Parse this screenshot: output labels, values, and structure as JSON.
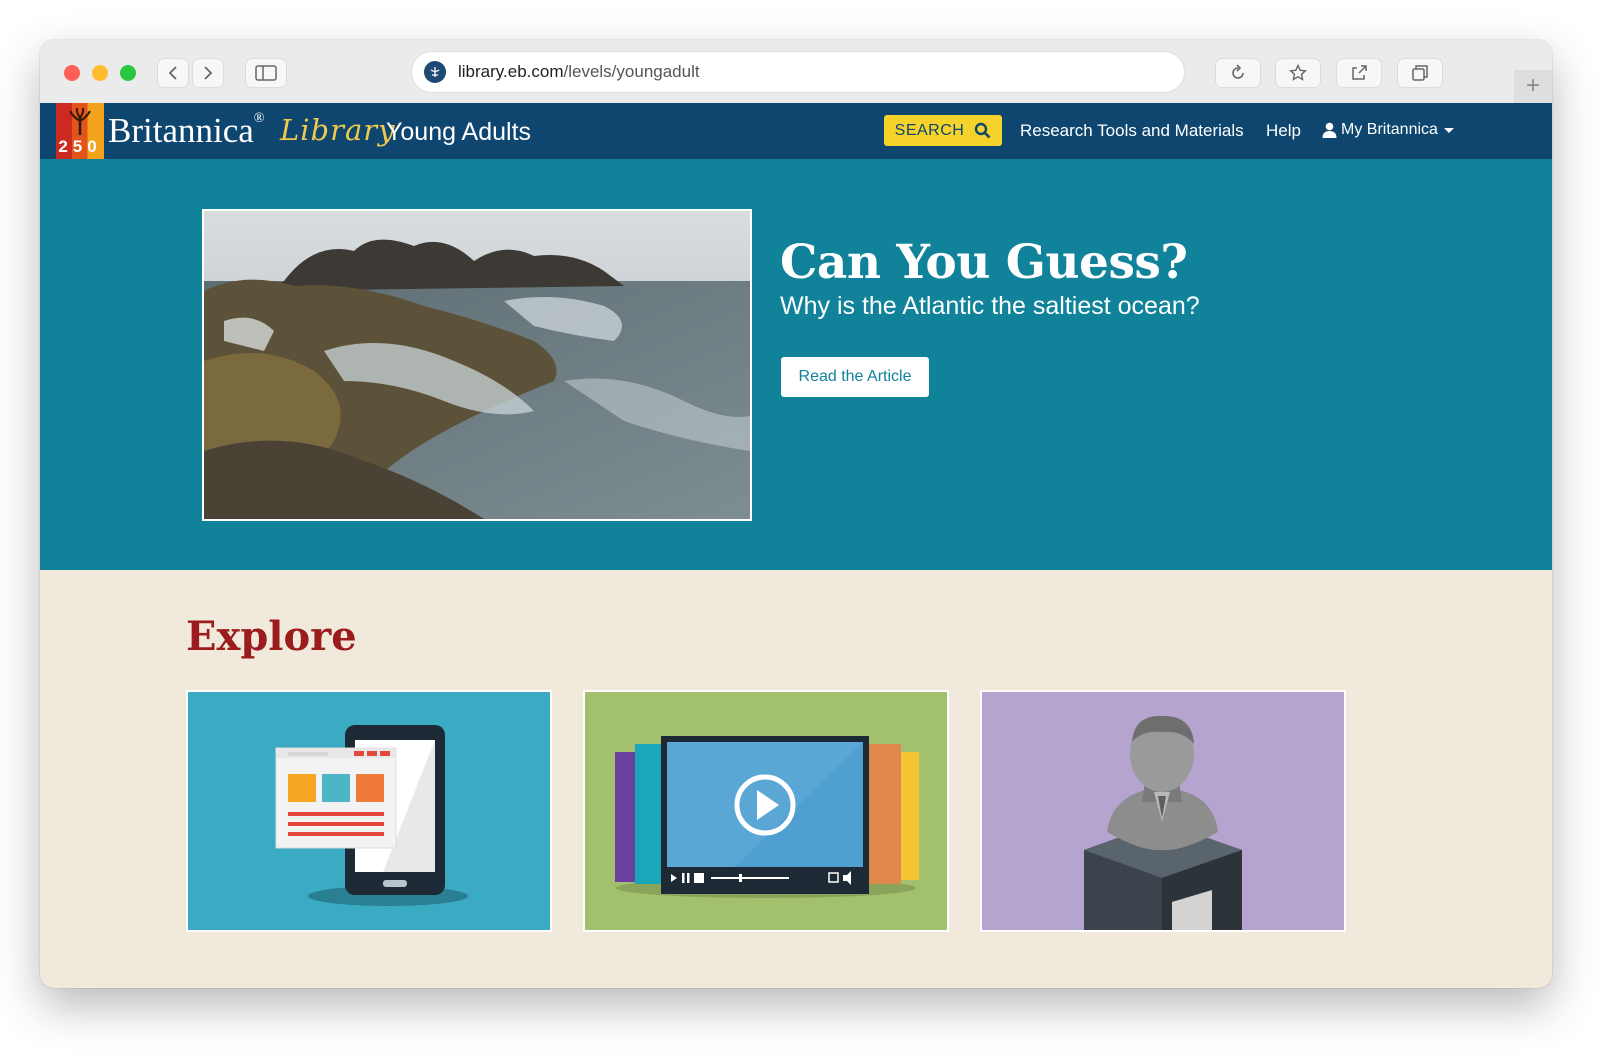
{
  "browser": {
    "url_domain": "library.eb.com",
    "url_path": "/levels/youngadult",
    "new_tab_label": "+"
  },
  "site": {
    "logo_number": "250",
    "brand_name": "Britannica",
    "brand_registered": "®",
    "brand_library": "Library",
    "brand_level": "Young Adults",
    "nav": {
      "search_label": "SEARCH",
      "research_label": "Research Tools and Materials",
      "help_label": "Help",
      "account_label": "My Britannica"
    }
  },
  "hero": {
    "title": "Can You Guess?",
    "subtitle": "Why is the Atlantic the saltiest ocean?",
    "button_label": "Read the Article"
  },
  "explore": {
    "title": "Explore",
    "cards": [
      {
        "icon": "mobile-articles-icon",
        "bg": "#3aabc3"
      },
      {
        "icon": "video-player-icon",
        "bg": "#a3c06f"
      },
      {
        "icon": "biography-bust-icon",
        "bg": "#b6a4d0"
      }
    ]
  },
  "colors": {
    "header_bg": "#0e4670",
    "hero_bg": "#10839a",
    "search_yellow": "#f5d32a",
    "explore_red": "#9a1c1c",
    "page_bg": "#f1e9dc"
  }
}
